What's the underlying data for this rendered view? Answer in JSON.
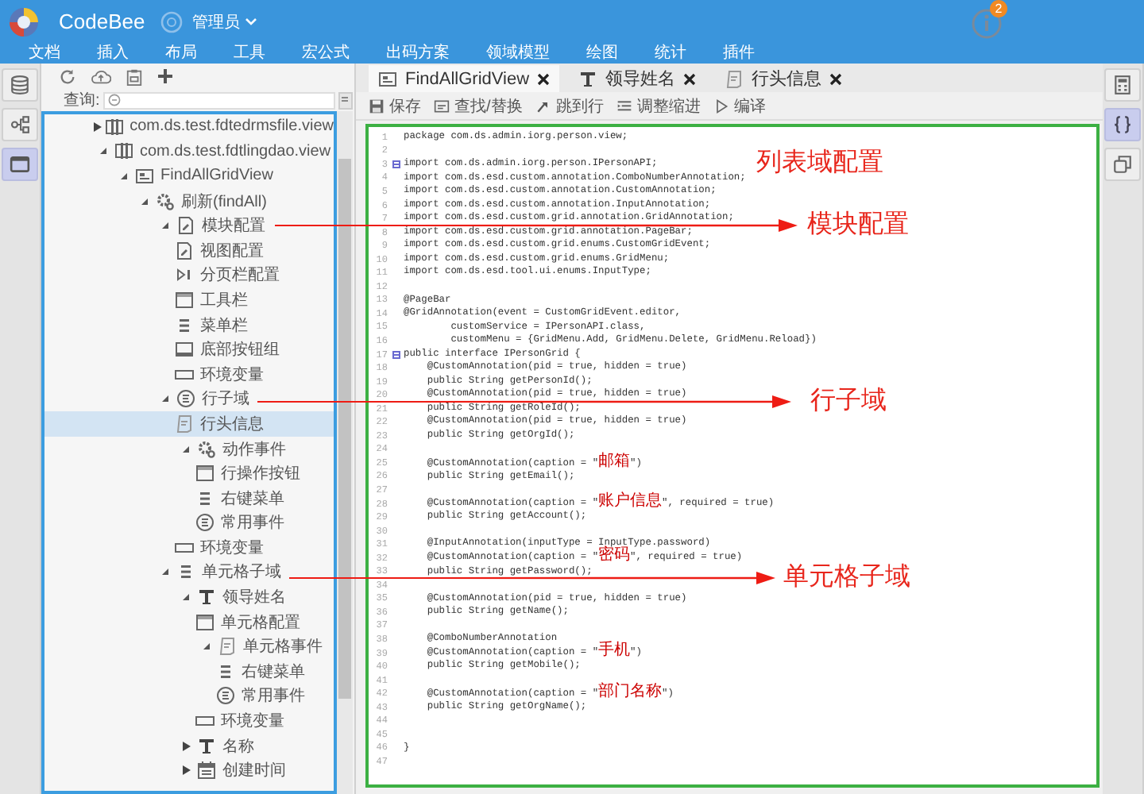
{
  "header": {
    "app_name": "CodeBee",
    "user": "管理员",
    "notification_count": "2"
  },
  "menu": [
    "文档",
    "插入",
    "布局",
    "工具",
    "宏公式",
    "出码方案",
    "领域模型",
    "绘图",
    "统计",
    "插件"
  ],
  "left_rail": [
    {
      "kind": "database",
      "selected": false
    },
    {
      "kind": "share",
      "selected": false
    },
    {
      "kind": "window",
      "selected": true
    }
  ],
  "tree_panel": {
    "search_label": "查询:",
    "items": [
      {
        "label": "com.ds.test.fdtedrmsfile.view",
        "kind": "package",
        "expanded": false,
        "selected": false
      },
      {
        "label": "com.ds.test.fdtlingdao.view",
        "kind": "package",
        "expanded": true,
        "selected": false,
        "children": [
          {
            "label": "FindAllGridView",
            "kind": "view",
            "expanded": true,
            "selected": false,
            "children": [
              {
                "label": "刷新(findAll)",
                "kind": "gear",
                "expanded": true,
                "selected": false,
                "children": [
                  {
                    "label": "模块配置",
                    "kind": "doc",
                    "expanded": true,
                    "selected": false,
                    "children": [
                      {
                        "label": "视图配置",
                        "kind": "doc",
                        "selected": false
                      },
                      {
                        "label": "分页栏配置",
                        "kind": "pager",
                        "selected": false
                      },
                      {
                        "label": "工具栏",
                        "kind": "toolbar",
                        "selected": false
                      },
                      {
                        "label": "菜单栏",
                        "kind": "menu",
                        "selected": false
                      },
                      {
                        "label": "底部按钮组",
                        "kind": "footer",
                        "selected": false
                      },
                      {
                        "label": "环境变量",
                        "kind": "env",
                        "selected": false
                      }
                    ]
                  },
                  {
                    "label": "行子域",
                    "kind": "event",
                    "expanded": true,
                    "selected": false,
                    "children": [
                      {
                        "label": "行头信息",
                        "kind": "note",
                        "selected": true
                      },
                      {
                        "label": "动作事件",
                        "kind": "gear",
                        "expanded": true,
                        "selected": false,
                        "children": [
                          {
                            "label": "行操作按钮",
                            "kind": "toolbar",
                            "selected": false
                          },
                          {
                            "label": "右键菜单",
                            "kind": "menu",
                            "selected": false
                          },
                          {
                            "label": "常用事件",
                            "kind": "event",
                            "selected": false
                          }
                        ]
                      },
                      {
                        "label": "环境变量",
                        "kind": "env",
                        "selected": false
                      }
                    ]
                  },
                  {
                    "label": "单元格子域",
                    "kind": "menu",
                    "expanded": true,
                    "selected": false,
                    "children": [
                      {
                        "label": "领导姓名",
                        "kind": "text",
                        "expanded": true,
                        "selected": false,
                        "children": [
                          {
                            "label": "单元格配置",
                            "kind": "toolbar",
                            "selected": false
                          },
                          {
                            "label": "单元格事件",
                            "kind": "note",
                            "expanded": true,
                            "selected": false,
                            "children": [
                              {
                                "label": "右键菜单",
                                "kind": "menu",
                                "selected": false
                              },
                              {
                                "label": "常用事件",
                                "kind": "event",
                                "selected": false
                              }
                            ]
                          },
                          {
                            "label": "环境变量",
                            "kind": "env",
                            "selected": false
                          }
                        ]
                      },
                      {
                        "label": "名称",
                        "kind": "text",
                        "expanded": false,
                        "selected": false
                      },
                      {
                        "label": "创建时间",
                        "kind": "calendar",
                        "expanded": false,
                        "selected": false
                      }
                    ]
                  }
                ]
              }
            ]
          }
        ]
      }
    ]
  },
  "editor": {
    "tabs": [
      {
        "label": "FindAllGridView",
        "kind": "view",
        "selected": true
      },
      {
        "label": "领导姓名",
        "kind": "text",
        "selected": false
      },
      {
        "label": "行头信息",
        "kind": "note",
        "selected": false
      }
    ],
    "toolbar": [
      {
        "kind": "save",
        "label": "保存"
      },
      {
        "kind": "find",
        "label": "查找/替换"
      },
      {
        "kind": "jump",
        "label": "跳到行"
      },
      {
        "kind": "indent",
        "label": "调整缩进"
      },
      {
        "kind": "compile",
        "label": "编译"
      }
    ],
    "lines": [
      {
        "number": "1",
        "text": "package com.ds.admin.iorg.person.view;",
        "fold": false
      },
      {
        "number": "2",
        "fold": false
      },
      {
        "number": "3",
        "text": "import com.ds.admin.iorg.person.IPersonAPI;",
        "fold": true
      },
      {
        "number": "4",
        "text": "import com.ds.esd.custom.annotation.ComboNumberAnnotation;",
        "fold": false
      },
      {
        "number": "5",
        "text": "import com.ds.esd.custom.annotation.CustomAnnotation;",
        "fold": false
      },
      {
        "number": "6",
        "text": "import com.ds.esd.custom.annotation.InputAnnotation;",
        "fold": false
      },
      {
        "number": "7",
        "text": "import com.ds.esd.custom.grid.annotation.GridAnnotation;",
        "fold": false
      },
      {
        "number": "8",
        "text": "import com.ds.esd.custom.grid.annotation.PageBar;",
        "fold": false
      },
      {
        "number": "9",
        "text": "import com.ds.esd.custom.grid.enums.CustomGridEvent;",
        "fold": false
      },
      {
        "number": "10",
        "text": "import com.ds.esd.custom.grid.enums.GridMenu;",
        "fold": false
      },
      {
        "number": "11",
        "text": "import com.ds.esd.tool.ui.enums.InputType;",
        "fold": false
      },
      {
        "number": "12",
        "fold": false
      },
      {
        "number": "13",
        "text": "@PageBar",
        "fold": false
      },
      {
        "number": "14",
        "text": "@GridAnnotation(event = CustomGridEvent.editor,",
        "fold": false
      },
      {
        "number": "15",
        "text": "        customService = IPersonAPI.class,",
        "fold": false
      },
      {
        "number": "16",
        "text": "        customMenu = {GridMenu.Add, GridMenu.Delete, GridMenu.Reload})",
        "fold": false
      },
      {
        "number": "17",
        "text": "public interface IPersonGrid {",
        "fold": true
      },
      {
        "number": "18",
        "text": "    @CustomAnnotation(pid = true, hidden = true)",
        "fold": false
      },
      {
        "number": "19",
        "text": "    public String getPersonId();",
        "fold": false
      },
      {
        "number": "20",
        "text": "    @CustomAnnotation(pid = true, hidden = true)",
        "fold": false
      },
      {
        "number": "21",
        "text": "    public String getRoleId();",
        "fold": false
      },
      {
        "number": "22",
        "text": "    @CustomAnnotation(pid = true, hidden = true)",
        "fold": false
      },
      {
        "number": "23",
        "text": "    public String getOrgId();",
        "fold": false
      },
      {
        "number": "24",
        "fold": false
      },
      {
        "number": "25",
        "text": "    @CustomAnnotation(caption = \"邮箱\")",
        "fold": false
      },
      {
        "number": "26",
        "text": "    public String getEmail();",
        "fold": false
      },
      {
        "number": "27",
        "fold": false
      },
      {
        "number": "28",
        "text": "    @CustomAnnotation(caption = \"账户信息\", required = true)",
        "fold": false
      },
      {
        "number": "29",
        "text": "    public String getAccount();",
        "fold": false
      },
      {
        "number": "30",
        "fold": false
      },
      {
        "number": "31",
        "text": "    @InputAnnotation(inputType = InputType.password)",
        "fold": false
      },
      {
        "number": "32",
        "text": "    @CustomAnnotation(caption = \"密码\", required = true)",
        "fold": false
      },
      {
        "number": "33",
        "text": "    public String getPassword();",
        "fold": false
      },
      {
        "number": "34",
        "fold": false
      },
      {
        "number": "35",
        "text": "    @CustomAnnotation(pid = true, hidden = true)",
        "fold": false
      },
      {
        "number": "36",
        "text": "    public String getName();",
        "fold": false
      },
      {
        "number": "37",
        "fold": false
      },
      {
        "number": "38",
        "text": "    @ComboNumberAnnotation",
        "fold": false
      },
      {
        "number": "39",
        "text": "    @CustomAnnotation(caption = \"手机\")",
        "fold": false
      },
      {
        "number": "40",
        "text": "    public String getMobile();",
        "fold": false
      },
      {
        "number": "41",
        "fold": false
      },
      {
        "number": "42",
        "text": "    @CustomAnnotation(caption = \"部门名称\")",
        "fold": false
      },
      {
        "number": "43",
        "text": "    public String getOrgName();",
        "fold": false
      },
      {
        "number": "44",
        "fold": false
      },
      {
        "number": "45",
        "fold": false
      },
      {
        "number": "46",
        "text": "}",
        "fold": false
      },
      {
        "number": "47",
        "fold": false
      }
    ]
  },
  "right_rail": [
    {
      "kind": "calculator",
      "selected": false
    },
    {
      "kind": "braces",
      "selected": true
    },
    {
      "kind": "copy",
      "selected": false
    }
  ],
  "annotations": [
    {
      "label": "列表域配置",
      "arrow": false
    },
    {
      "label": "模块配置",
      "arrow": true
    },
    {
      "label": "行子域",
      "arrow": true
    },
    {
      "label": "单元格子域",
      "arrow": true
    }
  ]
}
